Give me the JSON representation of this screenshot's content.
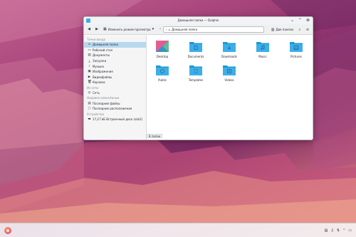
{
  "window": {
    "title": "Домашняя папка — Dolphin",
    "minimize_icon": "chevron-down-icon",
    "maximize_icon": "chevron-up-icon",
    "close_icon": "close-icon"
  },
  "toolbar": {
    "back_icon": "arrow-left-icon",
    "forward_icon": "arrow-right-icon",
    "view_mode_label": "Изменить режим просмотра",
    "location_text": "Домашняя папка",
    "split_label": "Две панели",
    "search_icon": "search-icon",
    "menu_icon": "hamburger-icon"
  },
  "sidebar": {
    "sections": [
      {
        "label": "Точки входа",
        "items": [
          {
            "label": "Домашняя папка",
            "icon": "home-icon"
          },
          {
            "label": "Рабочий стол",
            "icon": "desktop-icon"
          },
          {
            "label": "Документы",
            "icon": "document-icon"
          },
          {
            "label": "Загрузки",
            "icon": "download-icon"
          },
          {
            "label": "Музыка",
            "icon": "music-icon"
          },
          {
            "label": "Изображения",
            "icon": "image-icon"
          },
          {
            "label": "Видеофайлы",
            "icon": "video-icon"
          },
          {
            "label": "Корзина",
            "icon": "trash-icon"
          }
        ]
      },
      {
        "label": "Из сети",
        "items": [
          {
            "label": "Сеть",
            "icon": "network-icon"
          }
        ]
      },
      {
        "label": "Недавно изменённые",
        "items": [
          {
            "label": "Последние файлы",
            "icon": "recent-files-icon"
          },
          {
            "label": "Последние расположения",
            "icon": "recent-locations-icon"
          }
        ]
      },
      {
        "label": "Устройства",
        "items": [
          {
            "label": "17,2 ГиБ Встроенный диск (sda1)",
            "icon": "drive-icon"
          }
        ]
      }
    ]
  },
  "files": [
    {
      "name": "Desktop",
      "icon": "desktop-folder-icon"
    },
    {
      "name": "Documents",
      "icon": "documents-folder-icon"
    },
    {
      "name": "Downloads",
      "icon": "downloads-folder-icon"
    },
    {
      "name": "Music",
      "icon": "music-folder-icon"
    },
    {
      "name": "Pictures",
      "icon": "pictures-folder-icon"
    },
    {
      "name": "Public",
      "icon": "public-folder-icon"
    },
    {
      "name": "Templates",
      "icon": "templates-folder-icon"
    },
    {
      "name": "Videos",
      "icon": "videos-folder-icon"
    }
  ],
  "status": {
    "text": "8 папок"
  },
  "taskbar": {
    "launcher_icon": "app-launcher-icon",
    "clock_time": "",
    "clock_date": ""
  },
  "colors": {
    "folder": "#3daee9",
    "folder_dark": "#1d99d3",
    "selection": "#b7d8ee"
  }
}
